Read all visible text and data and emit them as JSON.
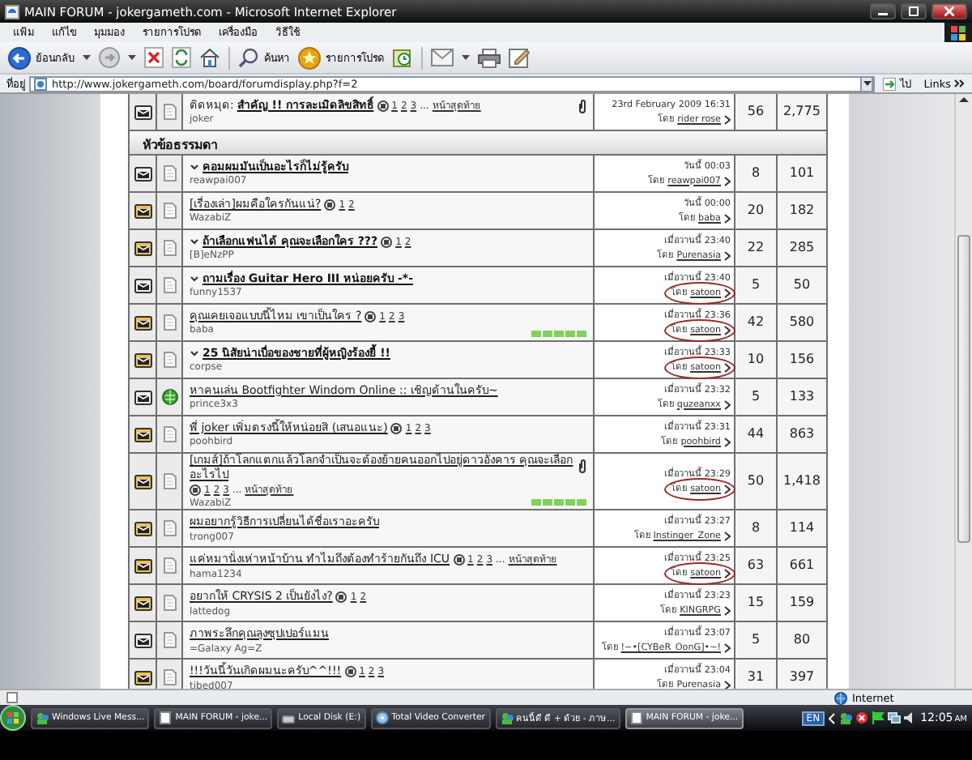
{
  "window": {
    "title": "MAIN FORUM - jokergameth.com - Microsoft Internet Explorer"
  },
  "menu": [
    "แฟ้ม",
    "แก้ไข",
    "มุมมอง",
    "รายการโปรด",
    "เครื่องมือ",
    "วิธีใช้"
  ],
  "toolbar": {
    "back": "ย้อนกลับ",
    "search": "ค้นหา",
    "favorites": "รายการโปรด"
  },
  "address": {
    "label": "ที่อยู่",
    "url": "http://www.jokergameth.com/board/forumdisplay.php?f=2",
    "go": "ไป",
    "links": "Links"
  },
  "forum": {
    "sticky": {
      "hot": false,
      "kind": "page",
      "bold": true,
      "prefix": "ติดหมุด:",
      "title": "สำคัญ !! การละเมิดลิขสิทธิ์",
      "pages": [
        "1",
        "2",
        "3"
      ],
      "more": "...",
      "last_page": "หน้าสุดท้าย",
      "author": "joker",
      "attachment": true,
      "date": "23rd February 2009 16:31",
      "by_label": "โดย",
      "by": "rider rose",
      "circled": false,
      "replies": "56",
      "views": "2,775"
    },
    "section": "หัวข้อธรรมดา",
    "threads": [
      {
        "hot": false,
        "kind": "page",
        "bold": true,
        "title": "คอมผมมันเป็นอะไรก็ไม่รู้ครับ",
        "author": "reawpai007",
        "attachment": false,
        "date": "วันนี้ 00:03",
        "by_label": "โดย",
        "by": "reawpai007",
        "circled": false,
        "replies": "8",
        "views": "101"
      },
      {
        "hot": true,
        "kind": "page",
        "bold": false,
        "title": "[เรื่องเล่า]ผมคือใครกันแน่?",
        "pages": [
          "1",
          "2"
        ],
        "author": "WazabiZ",
        "attachment": false,
        "date": "วันนี้ 00:00",
        "by_label": "โดย",
        "by": "baba",
        "circled": false,
        "replies": "20",
        "views": "182"
      },
      {
        "hot": true,
        "kind": "page",
        "bold": true,
        "title": "ถ้าเลือกแฟนได้ คุณจะเลือกใคร ???",
        "pages": [
          "1",
          "2"
        ],
        "author": "[B]eNzPP",
        "attachment": false,
        "date": "เมื่อวานนี้ 23:40",
        "by_label": "โดย",
        "by": "Purenasia",
        "circled": false,
        "replies": "22",
        "views": "285"
      },
      {
        "hot": false,
        "kind": "page",
        "bold": true,
        "title": "ถามเรื่อง Guitar Hero III หน่อยครับ -*-",
        "author": "funny1537",
        "attachment": false,
        "date": "เมื่อวานนี้ 23:40",
        "by_label": "โดย",
        "by": "satoon",
        "circled": true,
        "replies": "5",
        "views": "50"
      },
      {
        "hot": true,
        "kind": "page",
        "bold": false,
        "title": "คุณเคยเจอแบบนี้ไหม เขาเป็นใคร ?",
        "pages": [
          "1",
          "2",
          "3"
        ],
        "author": "baba",
        "stars": 5,
        "attachment": false,
        "date": "เมื่อวานนี้ 23:36",
        "by_label": "โดย",
        "by": "satoon",
        "circled": true,
        "replies": "42",
        "views": "580"
      },
      {
        "hot": true,
        "kind": "page",
        "bold": true,
        "title": "25 นิสัยน่าเบื่อของชายที่ผู้หญิงร้องยี้ !!",
        "author": "corpse",
        "attachment": false,
        "date": "เมื่อวานนี้ 23:33",
        "by_label": "โดย",
        "by": "satoon",
        "circled": true,
        "replies": "10",
        "views": "156"
      },
      {
        "hot": false,
        "kind": "globe",
        "bold": false,
        "title": "หาคนเล่น Bootfighter Windom Online :: เชิญด้านในครับ~",
        "author": "prince3x3",
        "attachment": false,
        "date": "เมื่อวานนี้ 23:32",
        "by_label": "โดย",
        "by": "quzeanxx",
        "circled": false,
        "replies": "5",
        "views": "133"
      },
      {
        "hot": true,
        "kind": "page",
        "bold": false,
        "title": "พี่ joker เพิ่มตรงนี้ให้หน่อยสิ (เสนอแนะ)",
        "pages": [
          "1",
          "2",
          "3"
        ],
        "author": "poohbird",
        "attachment": false,
        "date": "เมื่อวานนี้ 23:31",
        "by_label": "โดย",
        "by": "poohbird",
        "circled": false,
        "replies": "44",
        "views": "863"
      },
      {
        "hot": true,
        "kind": "page",
        "bold": false,
        "title": "[เกมส์]ถ้าโลกแตกแล้วโลกจำเป็นจะต้องย้ายคนออกไปอยู่ดาวอังคาร คุณจะเลือกอะไรไป",
        "pages": [
          "1",
          "2",
          "3"
        ],
        "more": "...",
        "last_page": "หน้าสุดท้าย",
        "author": "WazabiZ",
        "stars": 5,
        "attachment": true,
        "date": "เมื่อวานนี้ 23:29",
        "by_label": "โดย",
        "by": "satoon",
        "circled": true,
        "replies": "50",
        "views": "1,418"
      },
      {
        "hot": true,
        "kind": "page",
        "bold": false,
        "title": "ผมอยากรู้วิธีการเปลี่ยนได้ชื่อเราอะครับ",
        "author": "trong007",
        "attachment": false,
        "date": "เมื่อวานนี้ 23:27",
        "by_label": "โดย",
        "by": "Instinger_Zone",
        "circled": false,
        "replies": "8",
        "views": "114"
      },
      {
        "hot": true,
        "kind": "page",
        "bold": false,
        "title": "แค่หมานั่งเห่าหน้าบ้าน ทำไมถึงต้องทำร้ายกันถึง ICU",
        "pages": [
          "1",
          "2",
          "3"
        ],
        "more": "...",
        "last_page": "หน้าสุดท้าย",
        "author": "hama1234",
        "attachment": false,
        "date": "เมื่อวานนี้ 23:25",
        "by_label": "โดย",
        "by": "satoon",
        "circled": true,
        "replies": "63",
        "views": "661"
      },
      {
        "hot": true,
        "kind": "page",
        "bold": false,
        "title": "อยากให้ CRYSIS 2 เป็นยังไง?",
        "pages": [
          "1",
          "2"
        ],
        "author": "lattedog",
        "attachment": false,
        "date": "เมื่อวานนี้ 23:23",
        "by_label": "โดย",
        "by": "KINGRPG",
        "circled": false,
        "replies": "15",
        "views": "159"
      },
      {
        "hot": false,
        "kind": "page",
        "bold": false,
        "title": "ภาพระลึกคุณลุงซุปเปอร์แมน",
        "author": "=Galaxy Ag=Z",
        "attachment": false,
        "date": "เมื่อวานนี้ 23:07",
        "by_label": "โดย",
        "by": "!~•[CYBeR_OonG]•~!",
        "circled": false,
        "replies": "5",
        "views": "80"
      },
      {
        "hot": true,
        "kind": "page",
        "bold": false,
        "title": "!!!วันนี้วันเกิดผมนะครับ^^!!!",
        "pages": [
          "1",
          "2",
          "3"
        ],
        "author": "tibed007",
        "attachment": false,
        "date": "เมื่อวานนี้ 23:04",
        "by_label": "โดย",
        "by": "Purenasia",
        "circled": false,
        "replies": "31",
        "views": "397"
      }
    ]
  },
  "status_bar": {
    "zone": "Internet"
  },
  "taskbar": {
    "items": [
      {
        "label": "Windows Live Mess...",
        "kind": "people",
        "selected": false
      },
      {
        "label": "MAIN FORUM - joke...",
        "kind": "page",
        "selected": false
      },
      {
        "label": "Local Disk (E:)",
        "kind": "disk",
        "selected": false
      },
      {
        "label": "Total Video Converter",
        "kind": "disc",
        "selected": false
      },
      {
        "label": "คนนี้ดี ดี + ด้วย - ภาษ...",
        "kind": "people",
        "selected": false
      },
      {
        "label": "MAIN FORUM - joke...",
        "kind": "page",
        "selected": true
      }
    ],
    "lang": "EN",
    "time": "12:05",
    "ampm": "AM"
  }
}
